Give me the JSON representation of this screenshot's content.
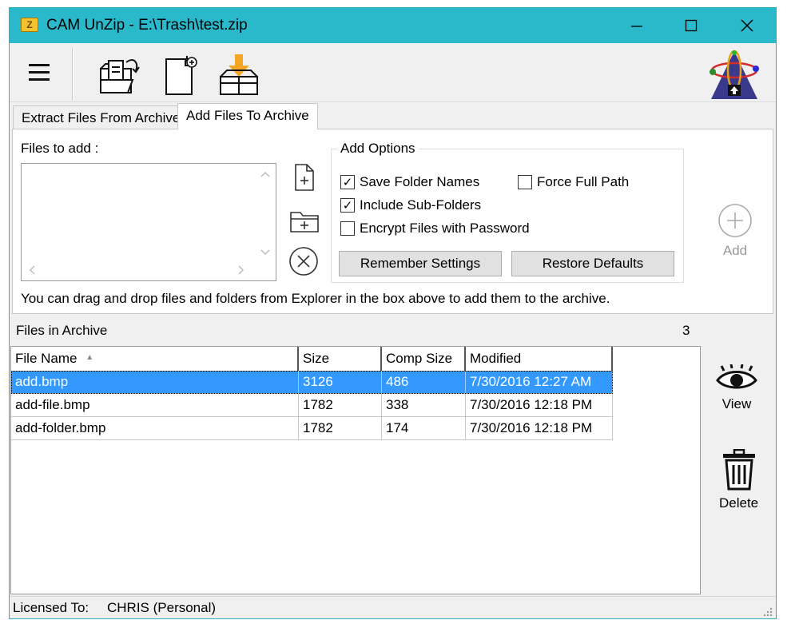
{
  "window": {
    "title": "CAM UnZip - E:\\Trash\\test.zip",
    "app_icon_letter": "Z"
  },
  "toolbar": {
    "menu_icon": "hamburger-icon",
    "extract_icon": "extract-folder-icon",
    "new_icon": "new-archive-icon",
    "add_icon": "add-to-box-icon",
    "logo_icon": "cam-unzip-logo-icon"
  },
  "tabs": [
    {
      "label": "Extract Files From Archive",
      "active": false
    },
    {
      "label": "Add Files To Archive",
      "active": true
    }
  ],
  "add_panel": {
    "files_label": "Files to add :",
    "hint": "You can drag and drop files and folders from Explorer in the box above to add them to the archive.",
    "options_title": "Add Options",
    "options": {
      "save_folder_names": {
        "label": "Save Folder Names",
        "checked": true
      },
      "force_full_path": {
        "label": "Force Full Path",
        "checked": false
      },
      "include_sub_folders": {
        "label": "Include Sub-Folders",
        "checked": true
      },
      "encrypt": {
        "label": "Encrypt Files with Password",
        "checked": false
      }
    },
    "remember_button": "Remember Settings",
    "restore_button": "Restore Defaults",
    "add_button": "Add"
  },
  "archive": {
    "title": "Files in Archive",
    "count": "3",
    "columns": [
      "File Name",
      "Size",
      "Comp Size",
      "Modified"
    ],
    "rows": [
      {
        "name": "add.bmp",
        "size": "3126",
        "comp": "486",
        "modified": "7/30/2016 12:27 AM",
        "selected": true
      },
      {
        "name": "add-file.bmp",
        "size": "1782",
        "comp": "338",
        "modified": "7/30/2016 12:18 PM",
        "selected": false
      },
      {
        "name": "add-folder.bmp",
        "size": "1782",
        "comp": "174",
        "modified": "7/30/2016 12:18 PM",
        "selected": false
      }
    ],
    "view_button": "View",
    "delete_button": "Delete"
  },
  "status": {
    "licensed_label": "Licensed To:",
    "licensee": "CHRIS (Personal)"
  },
  "colors": {
    "titlebar": "#2ab8cb",
    "selection": "#3399ff",
    "add_arrow": "#f5a623"
  }
}
